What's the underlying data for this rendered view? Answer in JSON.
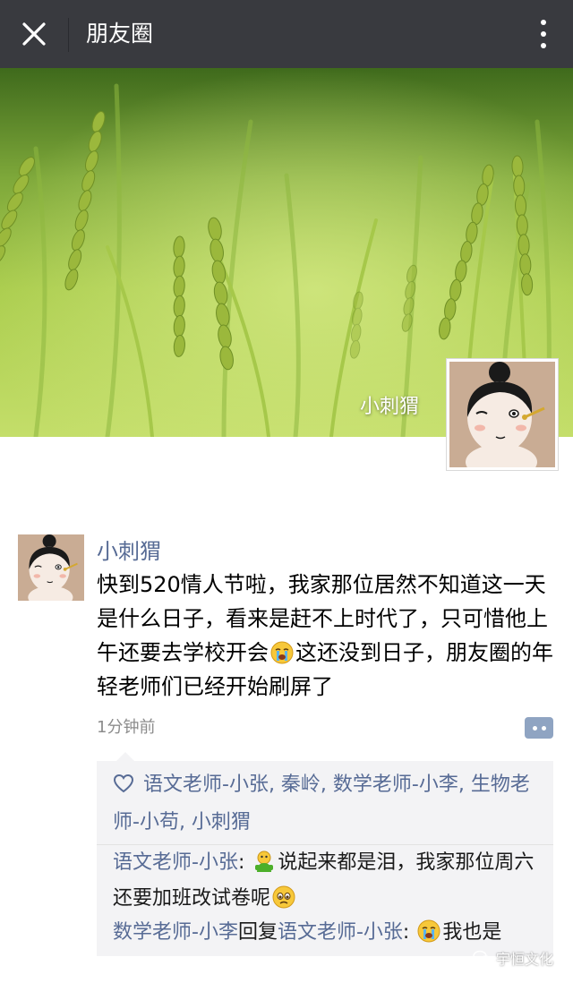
{
  "header": {
    "title": "朋友圈"
  },
  "cover": {
    "owner_name": "小刺猬"
  },
  "post": {
    "author": "小刺猬",
    "text_before_emoji": "快到520情人节啦，我家那位居然不知道这一天是什么日子，看来是赶不上时代了，只可惜他上午还要去学校开会",
    "text_after_emoji": "这还没到日子，朋友圈的年轻老师们已经开始刷屏了",
    "time": "1分钟前"
  },
  "likes": {
    "names": "语文老师-小张, 秦岭, 数学老师-小李, 生物老师-小苟, 小刺猬"
  },
  "comments": [
    {
      "name": "语文老师-小张",
      "separator": ": ",
      "text_before_emoji": "说起来都是泪，我家那位周六还要加班改试卷呢"
    },
    {
      "name": "数学老师-小李",
      "reply_word": "回复",
      "reply_to": "语文老师-小张",
      "separator": ": ",
      "text": "我也是"
    }
  ],
  "watermark": {
    "text": "宇恒文化"
  },
  "colors": {
    "topbar": "#393a3f",
    "link": "#576b95",
    "panel": "#f3f3f5"
  }
}
